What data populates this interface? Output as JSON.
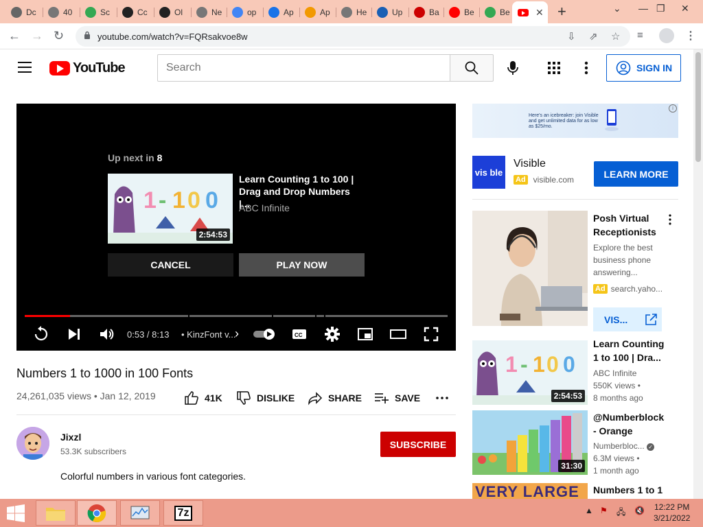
{
  "browser": {
    "tabs": [
      {
        "label": "Dc",
        "icon": "download-icon",
        "color": "#666"
      },
      {
        "label": "40",
        "icon": "globe-icon",
        "color": "#777"
      },
      {
        "label": "Sc",
        "icon": "drive-icon",
        "color": "#34a853"
      },
      {
        "label": "Cc",
        "icon": "github-icon",
        "color": "#222"
      },
      {
        "label": "Ol",
        "icon": "github-icon",
        "color": "#222"
      },
      {
        "label": "Ne",
        "icon": "globe-icon",
        "color": "#777"
      },
      {
        "label": "op",
        "icon": "google-icon",
        "color": "#4285f4"
      },
      {
        "label": "Ap",
        "icon": "app-icon",
        "color": "#1a73e8"
      },
      {
        "label": "Ap",
        "icon": "app-icon",
        "color": "#f29900"
      },
      {
        "label": "He",
        "icon": "globe-icon",
        "color": "#777"
      },
      {
        "label": "Up",
        "icon": "link-icon",
        "color": "#1a5fb4"
      },
      {
        "label": "Ba",
        "icon": "news-icon",
        "color": "#c00"
      },
      {
        "label": "Be",
        "icon": "youtube-icon",
        "color": "#f00"
      },
      {
        "label": "Be",
        "icon": "drive-icon",
        "color": "#34a853"
      }
    ],
    "active_tab_icon": "youtube-icon",
    "url": "youtube.com/watch?v=FQRsakvoe8w"
  },
  "header": {
    "logo_text": "YouTube",
    "search_placeholder": "Search",
    "signin_label": "SIGN IN"
  },
  "player": {
    "upnext_prefix": "Up next in",
    "countdown": "8",
    "upnext_title": "Learn Counting 1 to 100 | Drag and Drop Numbers |...",
    "upnext_channel": "ABC Infinite",
    "upnext_duration": "2:54:53",
    "cancel_label": "CANCEL",
    "playnow_label": "PLAY NOW",
    "time": "0:53 / 8:13",
    "chapter": "KinzFont v...",
    "progress": 0.107
  },
  "video": {
    "title": "Numbers 1 to 1000 in 100 Fonts",
    "meta": "24,261,035 views • Jan 12, 2019",
    "likes": "41K",
    "dislike_label": "DISLIKE",
    "share_label": "SHARE",
    "save_label": "SAVE",
    "channel_name": "Jixzl",
    "subscribers": "53.3K subscribers",
    "subscribe_label": "SUBSCRIBE",
    "description": "Colorful numbers in various font categories."
  },
  "sidebar": {
    "banner_text": "Here's an icebreaker: join Visible and get unlimited data for as low as $25/mo.",
    "ad1": {
      "logo_text": "vis ble",
      "name": "Visible",
      "badge": "Ad",
      "domain": "visible.com",
      "cta": "LEARN MORE"
    },
    "ad2": {
      "title": "Posh Virtual Receptionists",
      "description": "Explore the best business phone answering...",
      "badge": "Ad",
      "domain": "search.yaho...",
      "cta": "VIS..."
    },
    "recommendations": [
      {
        "title": "Learn Counting 1 to 100 | Dra...",
        "channel": "ABC Infinite",
        "views": "550K views •",
        "age": "8 months ago",
        "duration": "2:54:53"
      },
      {
        "title": "@Numberblocks - Orange Level...",
        "channel": "Numberbloc...",
        "views": "6.3M views •",
        "age": "1 month ago",
        "duration": "31:30"
      },
      {
        "title": "Numbers 1 to 1",
        "channel": "",
        "views": "",
        "age": "",
        "duration": ""
      }
    ],
    "rec3_thumb_text": "VERY LARGE"
  },
  "taskbar": {
    "time": "12:22 PM",
    "date": "3/21/2022",
    "seven_zip_label": "7z"
  },
  "colors": {
    "youtube_red": "#ff0000",
    "link_blue": "#065fd4",
    "tabstrip": "#f8c9b8",
    "taskbar": "#ec9b8a"
  }
}
